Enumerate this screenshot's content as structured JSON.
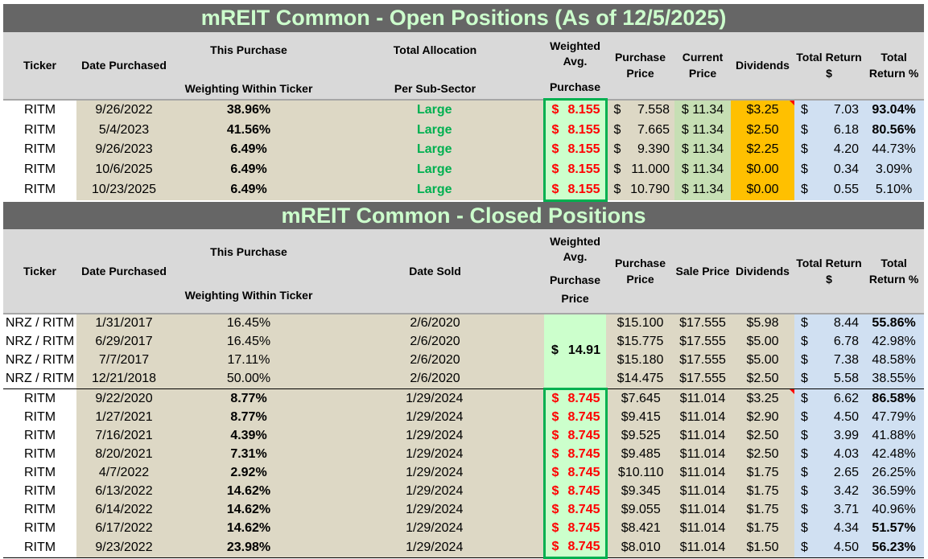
{
  "open": {
    "title": "mREIT Common - Open Positions (As of 12/5/2025)",
    "headers": {
      "ticker": "Ticker",
      "date_purchased": "Date Purchased",
      "this_purchase_top": "This Purchase",
      "this_purchase_bottom": "Weighting Within Ticker",
      "total_alloc_top": "Total Allocation",
      "total_alloc_bottom": "Per Sub-Sector",
      "wavg_top": "Weighted Avg.",
      "wavg_bottom": "Purchase",
      "purchase_price": "Purchase Price",
      "current_price": "Current Price",
      "dividends": "Dividends",
      "total_return_usd": "Total Return $",
      "total_return_pct": "Total Return %"
    },
    "rows": [
      {
        "ticker": "RITM",
        "date": "9/26/2022",
        "weight": "38.96%",
        "alloc": "Large",
        "wavg": "$ 8.155",
        "purchase": "$ 7.558",
        "current": "$ 11.34",
        "dividends": "$3.25",
        "ret_usd": "$ 7.03",
        "ret_pct": "93.04%",
        "pct_bold": true,
        "note": true
      },
      {
        "ticker": "RITM",
        "date": "5/4/2023",
        "weight": "41.56%",
        "alloc": "Large",
        "wavg": "$ 8.155",
        "purchase": "$ 7.665",
        "current": "$ 11.34",
        "dividends": "$2.50",
        "ret_usd": "$ 6.18",
        "ret_pct": "80.56%",
        "pct_bold": true
      },
      {
        "ticker": "RITM",
        "date": "9/26/2023",
        "weight": "6.49%",
        "alloc": "Large",
        "wavg": "$ 8.155",
        "purchase": "$ 9.390",
        "current": "$ 11.34",
        "dividends": "$2.25",
        "ret_usd": "$ 4.20",
        "ret_pct": "44.73%"
      },
      {
        "ticker": "RITM",
        "date": "10/6/2025",
        "weight": "6.49%",
        "alloc": "Large",
        "wavg": "$ 8.155",
        "purchase": "$ 11.000",
        "current": "$ 11.34",
        "dividends": "$0.00",
        "ret_usd": "$ 0.34",
        "ret_pct": "3.09%"
      },
      {
        "ticker": "RITM",
        "date": "10/23/2025",
        "weight": "6.49%",
        "alloc": "Large",
        "wavg": "$ 8.155",
        "purchase": "$ 10.790",
        "current": "$ 11.34",
        "dividends": "$0.00",
        "ret_usd": "$ 0.55",
        "ret_pct": "5.10%"
      }
    ]
  },
  "closed": {
    "title": "mREIT Common - Closed Positions",
    "headers": {
      "ticker": "Ticker",
      "date_purchased": "Date Purchased",
      "this_purchase_top": "This Purchase",
      "this_purchase_bottom": "Weighting Within Ticker",
      "date_sold": "Date Sold",
      "wavg_top": "Weighted Avg.",
      "wavg_bottom": "Purchase Price",
      "purchase_price": "Purchase Price",
      "sale_price": "Sale Price",
      "dividends": "Dividends",
      "total_return_usd": "Total Return $",
      "total_return_pct": "Total Return %"
    },
    "nrz_wavg": "$ 14.91",
    "nrz_rows": [
      {
        "ticker": "NRZ / RITM",
        "date": "1/31/2017",
        "weight": "16.45%",
        "sold": "2/6/2020",
        "purchase": "$15.100",
        "sale": "$17.555",
        "dividends": "$5.98",
        "ret_usd": "$ 8.44",
        "ret_pct": "55.86%",
        "pct_bold": true
      },
      {
        "ticker": "NRZ / RITM",
        "date": "6/29/2017",
        "weight": "16.45%",
        "sold": "2/6/2020",
        "purchase": "$15.775",
        "sale": "$17.555",
        "dividends": "$5.00",
        "ret_usd": "$ 6.78",
        "ret_pct": "42.98%"
      },
      {
        "ticker": "NRZ / RITM",
        "date": "7/7/2017",
        "weight": "17.11%",
        "sold": "2/6/2020",
        "purchase": "$15.180",
        "sale": "$17.555",
        "dividends": "$5.00",
        "ret_usd": "$ 7.38",
        "ret_pct": "48.58%"
      },
      {
        "ticker": "NRZ / RITM",
        "date": "12/21/2018",
        "weight": "50.00%",
        "sold": "2/6/2020",
        "purchase": "$14.475",
        "sale": "$17.555",
        "dividends": "$2.50",
        "ret_usd": "$ 5.58",
        "ret_pct": "38.55%"
      }
    ],
    "ritm_rows": [
      {
        "ticker": "RITM",
        "date": "9/22/2020",
        "weight": "8.77%",
        "sold": "1/29/2024",
        "wavg": "$ 8.745",
        "purchase": "$7.645",
        "sale": "$11.014",
        "dividends": "$3.25",
        "ret_usd": "$ 6.62",
        "ret_pct": "86.58%",
        "pct_bold": true,
        "note": true
      },
      {
        "ticker": "RITM",
        "date": "1/27/2021",
        "weight": "8.77%",
        "sold": "1/29/2024",
        "wavg": "$ 8.745",
        "purchase": "$9.415",
        "sale": "$11.014",
        "dividends": "$2.90",
        "ret_usd": "$ 4.50",
        "ret_pct": "47.79%"
      },
      {
        "ticker": "RITM",
        "date": "7/16/2021",
        "weight": "4.39%",
        "sold": "1/29/2024",
        "wavg": "$ 8.745",
        "purchase": "$9.525",
        "sale": "$11.014",
        "dividends": "$2.50",
        "ret_usd": "$ 3.99",
        "ret_pct": "41.88%"
      },
      {
        "ticker": "RITM",
        "date": "8/20/2021",
        "weight": "7.31%",
        "sold": "1/29/2024",
        "wavg": "$ 8.745",
        "purchase": "$9.485",
        "sale": "$11.014",
        "dividends": "$2.50",
        "ret_usd": "$ 4.03",
        "ret_pct": "42.48%"
      },
      {
        "ticker": "RITM",
        "date": "4/7/2022",
        "weight": "2.92%",
        "sold": "1/29/2024",
        "wavg": "$ 8.745",
        "purchase": "$10.110",
        "sale": "$11.014",
        "dividends": "$1.75",
        "ret_usd": "$ 2.65",
        "ret_pct": "26.25%"
      },
      {
        "ticker": "RITM",
        "date": "6/13/2022",
        "weight": "14.62%",
        "sold": "1/29/2024",
        "wavg": "$ 8.745",
        "purchase": "$9.345",
        "sale": "$11.014",
        "dividends": "$1.75",
        "ret_usd": "$ 3.42",
        "ret_pct": "36.59%"
      },
      {
        "ticker": "RITM",
        "date": "6/14/2022",
        "weight": "14.62%",
        "sold": "1/29/2024",
        "wavg": "$ 8.745",
        "purchase": "$9.055",
        "sale": "$11.014",
        "dividends": "$1.75",
        "ret_usd": "$ 3.71",
        "ret_pct": "40.96%"
      },
      {
        "ticker": "RITM",
        "date": "6/17/2022",
        "weight": "14.62%",
        "sold": "1/29/2024",
        "wavg": "$ 8.745",
        "purchase": "$8.421",
        "sale": "$11.014",
        "dividends": "$1.75",
        "ret_usd": "$ 4.34",
        "ret_pct": "51.57%",
        "pct_bold": true
      },
      {
        "ticker": "RITM",
        "date": "9/23/2022",
        "weight": "23.98%",
        "sold": "1/29/2024",
        "wavg": "$ 8.745",
        "purchase": "$8.010",
        "sale": "$11.014",
        "dividends": "$1.50",
        "ret_usd": "$ 4.50",
        "ret_pct": "56.23%",
        "pct_bold": true
      }
    ]
  }
}
